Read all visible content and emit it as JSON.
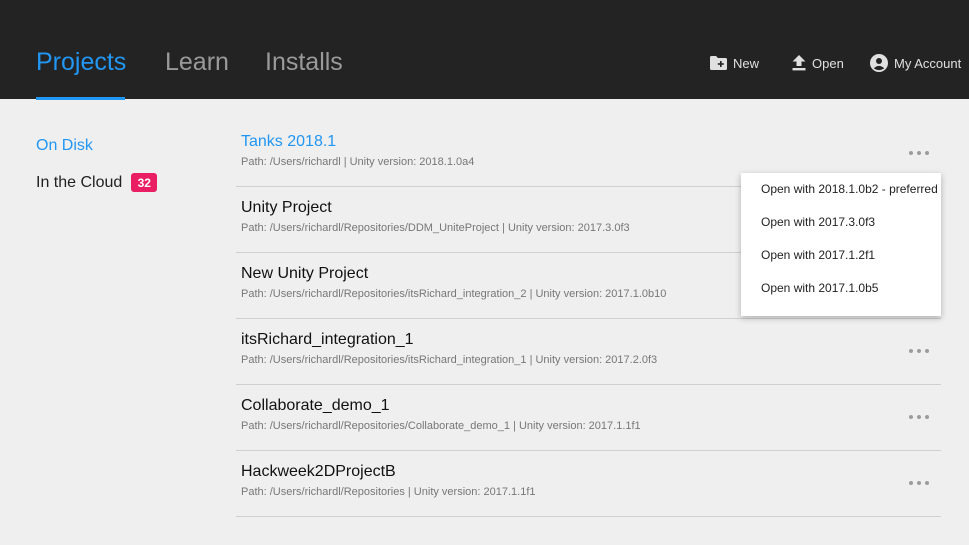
{
  "header": {
    "tabs": [
      {
        "label": "Projects"
      },
      {
        "label": "Learn"
      },
      {
        "label": "Installs"
      }
    ],
    "actions": {
      "new_label": "New",
      "open_label": "Open",
      "account_label": "My Account"
    },
    "accent_color": "#2196f3",
    "background_color": "#232323"
  },
  "sidebar": {
    "items": [
      {
        "label": "On Disk"
      },
      {
        "label": "In the Cloud",
        "badge": "32"
      }
    ],
    "badge_color": "#e91e63"
  },
  "projects": [
    {
      "name": "Tanks 2018.1",
      "path": "Path: /Users/richardl | Unity version: 2018.1.0a4"
    },
    {
      "name": "Unity Project",
      "path": "Path: /Users/richardl/Repositories/DDM_UniteProject | Unity version: 2017.3.0f3"
    },
    {
      "name": "New Unity Project",
      "path": "Path: /Users/richardl/Repositories/itsRichard_integration_2 | Unity version: 2017.1.0b10"
    },
    {
      "name": "itsRichard_integration_1",
      "path": "Path: /Users/richardl/Repositories/itsRichard_integration_1 | Unity version: 2017.2.0f3"
    },
    {
      "name": "Collaborate_demo_1",
      "path": "Path: /Users/richardl/Repositories/Collaborate_demo_1 | Unity version: 2017.1.1f1"
    },
    {
      "name": "Hackweek2DProjectB",
      "path": "Path: /Users/richardl/Repositories | Unity version: 2017.1.1f1"
    }
  ],
  "open_menu": {
    "items": [
      {
        "label": "Open with 2018.1.0b2 - preferred"
      },
      {
        "label": "Open with 2017.3.0f3"
      },
      {
        "label": "Open with 2017.1.2f1"
      },
      {
        "label": "Open with 2017.1.0b5"
      }
    ]
  }
}
